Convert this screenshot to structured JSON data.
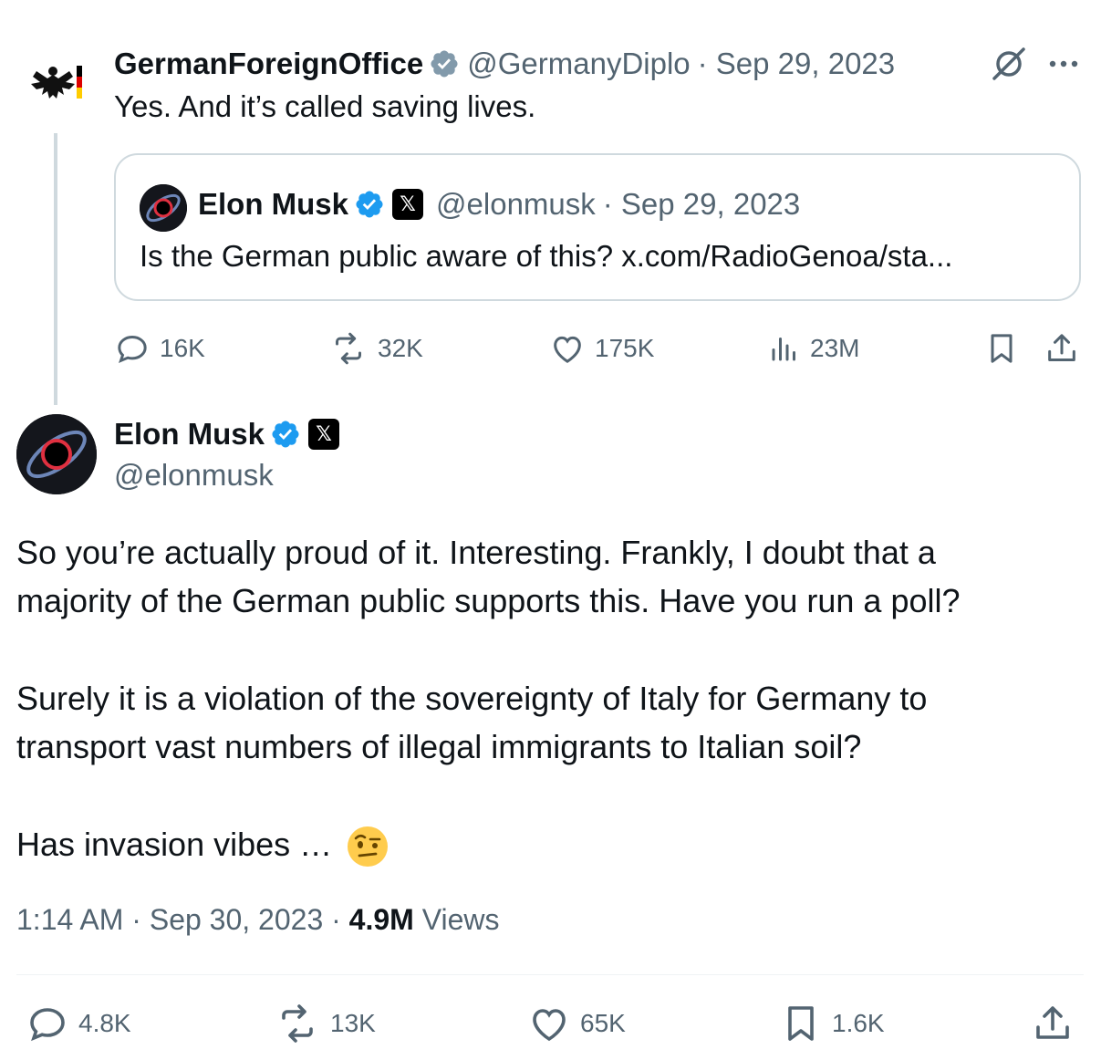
{
  "parent_tweet": {
    "name": "GermanForeignOffice",
    "handle": "@GermanyDiplo",
    "date": "· Sep 29, 2023",
    "text": "Yes. And it’s called saving lives.",
    "quote": {
      "name": "Elon Musk",
      "handle": "@elonmusk",
      "date": "· Sep 29, 2023",
      "text": "Is the German public aware of this? x.com/RadioGenoa/sta..."
    },
    "actions": {
      "replies": "16K",
      "reposts": "32K",
      "likes": "175K",
      "views": "23M"
    }
  },
  "main_tweet": {
    "name": "Elon Musk",
    "handle": "@elonmusk",
    "lines": [
      "So you’re actually proud of it. Interesting. Frankly, I doubt that a",
      "majority of the German public supports this. Have you run a poll?",
      "Surely it is a violation of the sovereignty of Italy for Germany to",
      "transport vast numbers of illegal immigrants to Italian soil?",
      "Has invasion vibes …"
    ],
    "time": "1:14 AM",
    "date": "Sep 30, 2023",
    "views_count": "4.9M",
    "views_label": "Views",
    "actions": {
      "replies": "4.8K",
      "reposts": "13K",
      "likes": "65K",
      "bookmarks": "1.6K"
    }
  },
  "colors": {
    "verified_blue": "#1d9bf0",
    "gov_gray": "#829aab",
    "text_gray": "#536471"
  },
  "icons": [
    "grok-icon",
    "more-icon",
    "reply-icon",
    "repost-icon",
    "like-icon",
    "views-icon",
    "bookmark-icon",
    "share-icon",
    "verified-badge-icon",
    "x-affiliation-icon",
    "raised-eyebrow-emoji"
  ]
}
